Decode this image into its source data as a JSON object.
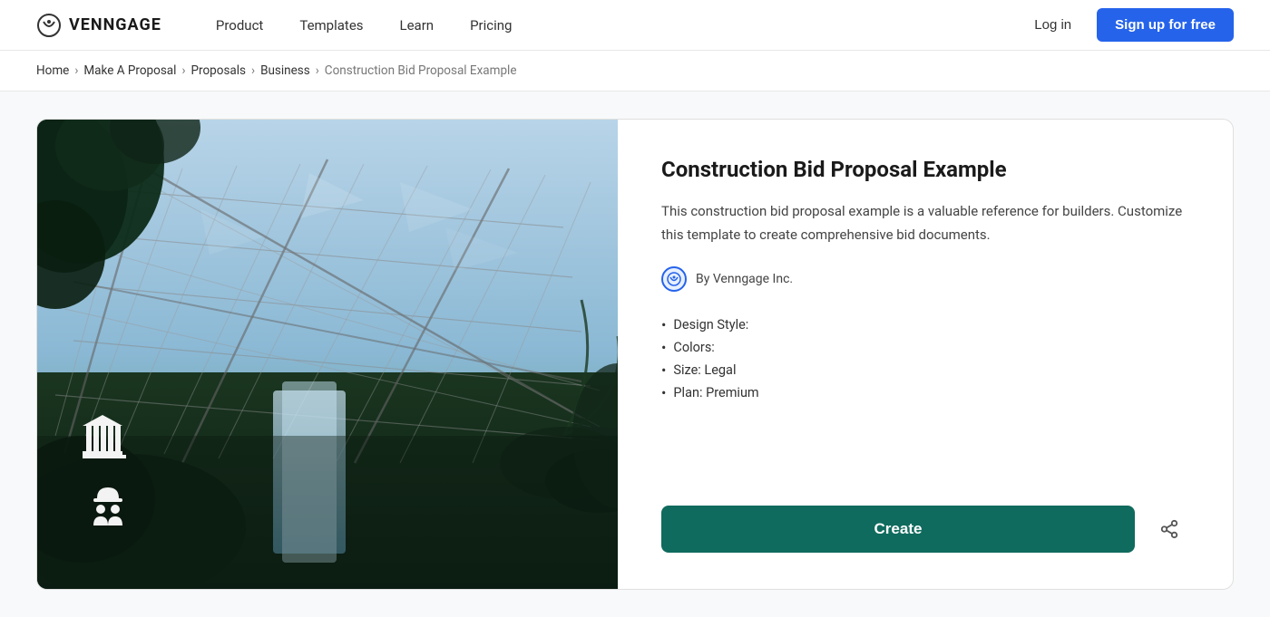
{
  "brand": {
    "logo_text": "VENNGAGE",
    "logo_icon": "clock-icon"
  },
  "nav": {
    "links": [
      {
        "label": "Product",
        "id": "product"
      },
      {
        "label": "Templates",
        "id": "templates"
      },
      {
        "label": "Learn",
        "id": "learn"
      },
      {
        "label": "Pricing",
        "id": "pricing"
      }
    ],
    "login_label": "Log in",
    "signup_label": "Sign up for free"
  },
  "breadcrumb": {
    "items": [
      {
        "label": "Home",
        "active": true
      },
      {
        "label": "Make A Proposal",
        "active": true
      },
      {
        "label": "Proposals",
        "active": true
      },
      {
        "label": "Business",
        "active": true
      },
      {
        "label": "Construction Bid Proposal Example",
        "active": false
      }
    ]
  },
  "template": {
    "title": "Construction Bid Proposal Example",
    "description": "This construction bid proposal example is a valuable reference for builders. Customize this template to create comprehensive bid documents.",
    "author": "By Venngage Inc.",
    "details": [
      {
        "label": "Design Style:"
      },
      {
        "label": "Colors:"
      },
      {
        "label": "Size: Legal"
      },
      {
        "label": "Plan: Premium"
      }
    ],
    "create_label": "Create",
    "share_icon": "share-icon"
  }
}
